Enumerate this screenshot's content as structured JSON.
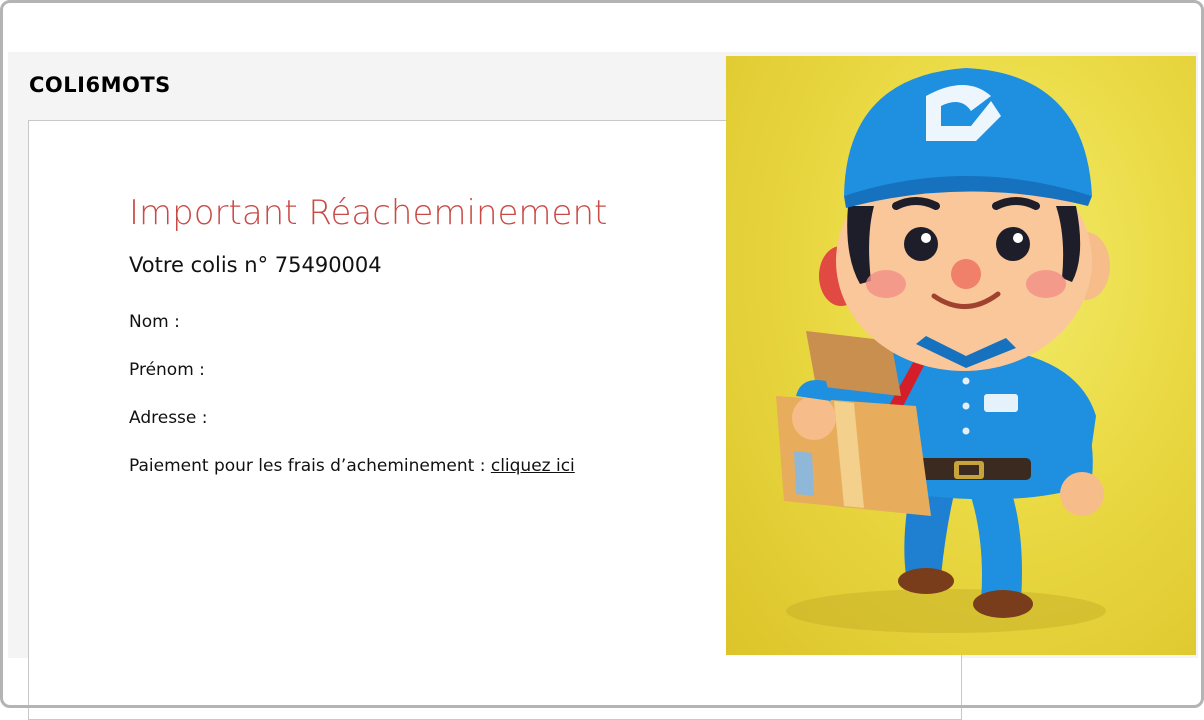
{
  "brand": "COLI6MOTS",
  "notice": {
    "title": "Important Réacheminement",
    "subtitle": "Votre colis n° 75490004",
    "fields": {
      "nom_label": "Nom :",
      "prenom_label": "Prénom :",
      "adresse_label": "Adresse :",
      "paiement_label": "Paiement pour les frais d’acheminement :",
      "paiement_link": "cliquez ici"
    }
  },
  "colors": {
    "title": "#c94a47",
    "hero_background": "#ead943",
    "uniform": "#1f8fe0"
  },
  "hero_image": {
    "icon": "delivery-man-illustration"
  }
}
